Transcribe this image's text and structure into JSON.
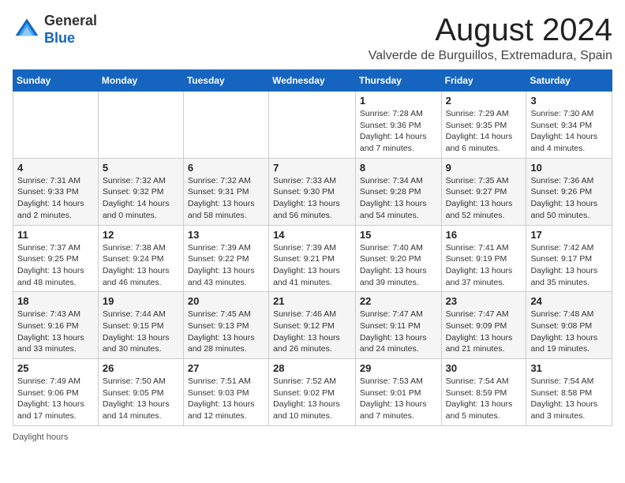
{
  "header": {
    "logo_general": "General",
    "logo_blue": "Blue",
    "title": "August 2024",
    "subtitle": "Valverde de Burguillos, Extremadura, Spain"
  },
  "days_of_week": [
    "Sunday",
    "Monday",
    "Tuesday",
    "Wednesday",
    "Thursday",
    "Friday",
    "Saturday"
  ],
  "weeks": [
    [
      {
        "day": "",
        "info": ""
      },
      {
        "day": "",
        "info": ""
      },
      {
        "day": "",
        "info": ""
      },
      {
        "day": "",
        "info": ""
      },
      {
        "day": "1",
        "info": "Sunrise: 7:28 AM\nSunset: 9:36 PM\nDaylight: 14 hours and 7 minutes."
      },
      {
        "day": "2",
        "info": "Sunrise: 7:29 AM\nSunset: 9:35 PM\nDaylight: 14 hours and 6 minutes."
      },
      {
        "day": "3",
        "info": "Sunrise: 7:30 AM\nSunset: 9:34 PM\nDaylight: 14 hours and 4 minutes."
      }
    ],
    [
      {
        "day": "4",
        "info": "Sunrise: 7:31 AM\nSunset: 9:33 PM\nDaylight: 14 hours and 2 minutes."
      },
      {
        "day": "5",
        "info": "Sunrise: 7:32 AM\nSunset: 9:32 PM\nDaylight: 14 hours and 0 minutes."
      },
      {
        "day": "6",
        "info": "Sunrise: 7:32 AM\nSunset: 9:31 PM\nDaylight: 13 hours and 58 minutes."
      },
      {
        "day": "7",
        "info": "Sunrise: 7:33 AM\nSunset: 9:30 PM\nDaylight: 13 hours and 56 minutes."
      },
      {
        "day": "8",
        "info": "Sunrise: 7:34 AM\nSunset: 9:28 PM\nDaylight: 13 hours and 54 minutes."
      },
      {
        "day": "9",
        "info": "Sunrise: 7:35 AM\nSunset: 9:27 PM\nDaylight: 13 hours and 52 minutes."
      },
      {
        "day": "10",
        "info": "Sunrise: 7:36 AM\nSunset: 9:26 PM\nDaylight: 13 hours and 50 minutes."
      }
    ],
    [
      {
        "day": "11",
        "info": "Sunrise: 7:37 AM\nSunset: 9:25 PM\nDaylight: 13 hours and 48 minutes."
      },
      {
        "day": "12",
        "info": "Sunrise: 7:38 AM\nSunset: 9:24 PM\nDaylight: 13 hours and 46 minutes."
      },
      {
        "day": "13",
        "info": "Sunrise: 7:39 AM\nSunset: 9:22 PM\nDaylight: 13 hours and 43 minutes."
      },
      {
        "day": "14",
        "info": "Sunrise: 7:39 AM\nSunset: 9:21 PM\nDaylight: 13 hours and 41 minutes."
      },
      {
        "day": "15",
        "info": "Sunrise: 7:40 AM\nSunset: 9:20 PM\nDaylight: 13 hours and 39 minutes."
      },
      {
        "day": "16",
        "info": "Sunrise: 7:41 AM\nSunset: 9:19 PM\nDaylight: 13 hours and 37 minutes."
      },
      {
        "day": "17",
        "info": "Sunrise: 7:42 AM\nSunset: 9:17 PM\nDaylight: 13 hours and 35 minutes."
      }
    ],
    [
      {
        "day": "18",
        "info": "Sunrise: 7:43 AM\nSunset: 9:16 PM\nDaylight: 13 hours and 33 minutes."
      },
      {
        "day": "19",
        "info": "Sunrise: 7:44 AM\nSunset: 9:15 PM\nDaylight: 13 hours and 30 minutes."
      },
      {
        "day": "20",
        "info": "Sunrise: 7:45 AM\nSunset: 9:13 PM\nDaylight: 13 hours and 28 minutes."
      },
      {
        "day": "21",
        "info": "Sunrise: 7:46 AM\nSunset: 9:12 PM\nDaylight: 13 hours and 26 minutes."
      },
      {
        "day": "22",
        "info": "Sunrise: 7:47 AM\nSunset: 9:11 PM\nDaylight: 13 hours and 24 minutes."
      },
      {
        "day": "23",
        "info": "Sunrise: 7:47 AM\nSunset: 9:09 PM\nDaylight: 13 hours and 21 minutes."
      },
      {
        "day": "24",
        "info": "Sunrise: 7:48 AM\nSunset: 9:08 PM\nDaylight: 13 hours and 19 minutes."
      }
    ],
    [
      {
        "day": "25",
        "info": "Sunrise: 7:49 AM\nSunset: 9:06 PM\nDaylight: 13 hours and 17 minutes."
      },
      {
        "day": "26",
        "info": "Sunrise: 7:50 AM\nSunset: 9:05 PM\nDaylight: 13 hours and 14 minutes."
      },
      {
        "day": "27",
        "info": "Sunrise: 7:51 AM\nSunset: 9:03 PM\nDaylight: 13 hours and 12 minutes."
      },
      {
        "day": "28",
        "info": "Sunrise: 7:52 AM\nSunset: 9:02 PM\nDaylight: 13 hours and 10 minutes."
      },
      {
        "day": "29",
        "info": "Sunrise: 7:53 AM\nSunset: 9:01 PM\nDaylight: 13 hours and 7 minutes."
      },
      {
        "day": "30",
        "info": "Sunrise: 7:54 AM\nSunset: 8:59 PM\nDaylight: 13 hours and 5 minutes."
      },
      {
        "day": "31",
        "info": "Sunrise: 7:54 AM\nSunset: 8:58 PM\nDaylight: 13 hours and 3 minutes."
      }
    ]
  ],
  "footer": {
    "daylight_label": "Daylight hours"
  }
}
